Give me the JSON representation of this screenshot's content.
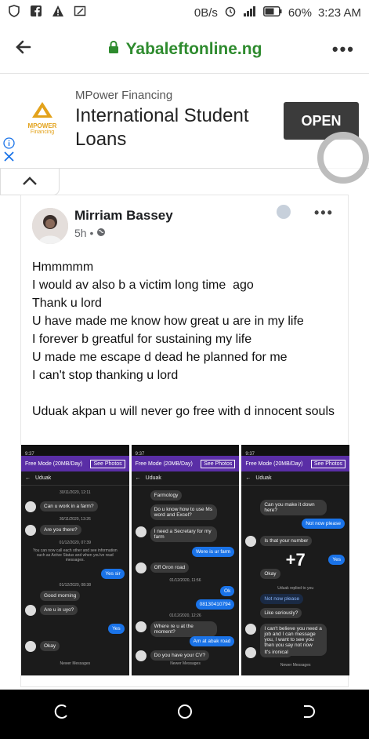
{
  "status": {
    "speed": "0B/s",
    "battery": "60%",
    "time": "3:23 AM",
    "icons": [
      "shield-icon",
      "facebook-icon",
      "warning-icon",
      "screenshot-icon",
      "alarm-icon",
      "signal-icon",
      "battery-icon"
    ]
  },
  "browser": {
    "url": "Yabaleftonline.ng",
    "back_icon": "arrow-left-icon",
    "lock_icon": "lock-icon",
    "more_icon": "more-dots-icon"
  },
  "ad": {
    "logo_text": "MPOWER",
    "logo_sub": "Financing",
    "sponsor": "MPower Financing",
    "headline": "International Student Loans",
    "cta": "OPEN",
    "info_icon": "info-icon",
    "close_icon": "close-icon"
  },
  "post": {
    "author": "Mirriam Bassey",
    "time": "5h",
    "privacy_icon": "globe-icon",
    "text": "Hmmmmm\nI would av also b a victim long time  ago\nThank u lord\nU have made me know how great u are in my life\nI forever b greatful for sustaining my life\nU made me escape d dead he planned for me\nI can't stop thanking u lord\n\nUduak akpan u will never go free with d innocent souls",
    "more_photos": "+7"
  },
  "shots": [
    {
      "time": "9:37",
      "mode": "Free Mode (20MB/Day)",
      "see": "See Photos",
      "name": "Uduak",
      "messages": [
        {
          "dir": "ts",
          "text": "30/11/2020, 12:11"
        },
        {
          "dir": "in",
          "text": "Can u work in a farm?"
        },
        {
          "dir": "ts",
          "text": "30/11/2020, 13:26"
        },
        {
          "dir": "in",
          "text": "Are you there?"
        },
        {
          "dir": "ts",
          "text": "01/12/2020, 07:39"
        },
        {
          "dir": "ts",
          "text": "You can now call each other and see information such as Active Status and when you've read messages."
        },
        {
          "dir": "out",
          "text": "Yes sir"
        },
        {
          "dir": "ts",
          "text": "01/12/2020, 08:38"
        },
        {
          "dir": "in",
          "text": "Good morning"
        },
        {
          "dir": "in",
          "text": "Are u in uyo?"
        },
        {
          "dir": "out",
          "text": "Yes"
        },
        {
          "dir": "in",
          "text": "Okay"
        },
        {
          "dir": "ts",
          "text": "Newer Messages"
        }
      ]
    },
    {
      "time": "9:37",
      "mode": "Free Mode (20MB/Day)",
      "see": "See Photos",
      "name": "Uduak",
      "messages": [
        {
          "dir": "in",
          "text": "Farmology"
        },
        {
          "dir": "in",
          "text": "Do u know how to use Ms word and Excel?"
        },
        {
          "dir": "in",
          "text": "I need a Secretary for my farm"
        },
        {
          "dir": "out",
          "text": "Were is ur farm"
        },
        {
          "dir": "in",
          "text": "Off Oron road"
        },
        {
          "dir": "ts",
          "text": "01/12/2020, 11:56"
        },
        {
          "dir": "out",
          "text": "Ok"
        },
        {
          "dir": "out",
          "text": "08130410794"
        },
        {
          "dir": "ts",
          "text": "01/12/2020, 12:26"
        },
        {
          "dir": "in",
          "text": "Where re u at the moment?"
        },
        {
          "dir": "out",
          "text": "Am at abak road"
        },
        {
          "dir": "in",
          "text": "Do you have your CV?"
        },
        {
          "dir": "ts",
          "text": "Newer Messages"
        }
      ]
    },
    {
      "time": "9:37",
      "mode": "Free Mode (20MB/Day)",
      "see": "See Photos",
      "name": "Uduak",
      "messages": [
        {
          "dir": "in",
          "text": "Can you make it down here?"
        },
        {
          "dir": "out",
          "text": "Not now please"
        },
        {
          "dir": "in",
          "text": "Is that your number"
        },
        {
          "dir": "out",
          "text": "Yes"
        },
        {
          "dir": "in",
          "text": "Okay"
        },
        {
          "dir": "ts",
          "text": "Uduak replied to you"
        },
        {
          "dir": "in",
          "text": "Not now please"
        },
        {
          "dir": "in",
          "text": "Like seriously?"
        },
        {
          "dir": "in",
          "text": "I can't believe you need a job and I can message you, I want to see you then you say not now please"
        },
        {
          "dir": "in",
          "text": "It's ironical"
        },
        {
          "dir": "ts",
          "text": "Newer Messages"
        }
      ]
    }
  ],
  "nav": {
    "recent_icon": "recent-apps-icon",
    "home_icon": "home-circle-icon",
    "back_icon": "back-nav-icon"
  }
}
